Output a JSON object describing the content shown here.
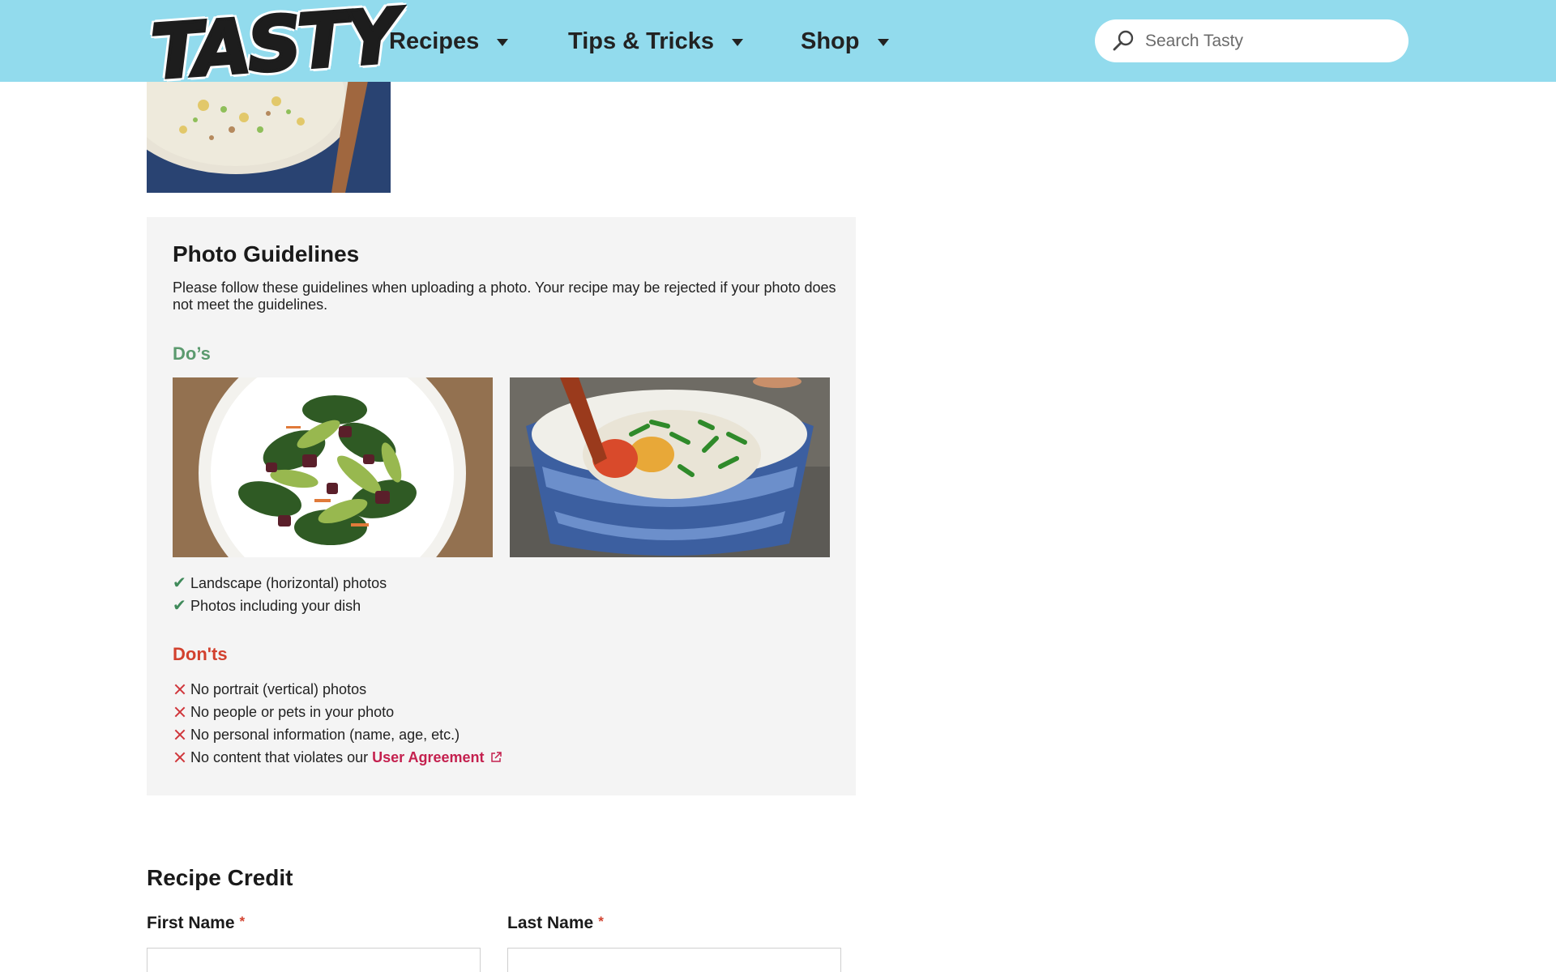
{
  "header": {
    "logo_text": "TASTY",
    "nav": [
      {
        "label": "Recipes"
      },
      {
        "label": "Tips & Tricks"
      },
      {
        "label": "Shop"
      }
    ],
    "search_placeholder": "Search Tasty"
  },
  "guidelines": {
    "title": "Photo Guidelines",
    "description": "Please follow these guidelines when uploading a photo. Your recipe may be rejected if your photo does not meet the guidelines.",
    "dos_title": "Do’s",
    "dos": [
      "Landscape (horizontal) photos",
      "Photos including your dish"
    ],
    "donts_title": "Don'ts",
    "donts": [
      "No portrait (vertical) photos",
      "No people or pets in your photo",
      "No personal information (name, age, etc.)",
      "No content that violates our"
    ],
    "user_agreement_link": "User Agreement"
  },
  "credit": {
    "title": "Recipe Credit",
    "first_name_label": "First Name",
    "last_name_label": "Last Name",
    "required_marker": "*"
  },
  "colors": {
    "header_bg": "#92dbed",
    "panel_bg": "#f4f4f4",
    "dos_green": "#5b9a6e",
    "donts_red": "#d2412e",
    "link_red": "#c4204e"
  },
  "icons": [
    "search-icon",
    "chevron-down-icon",
    "check-icon",
    "x-icon",
    "external-link-icon"
  ]
}
